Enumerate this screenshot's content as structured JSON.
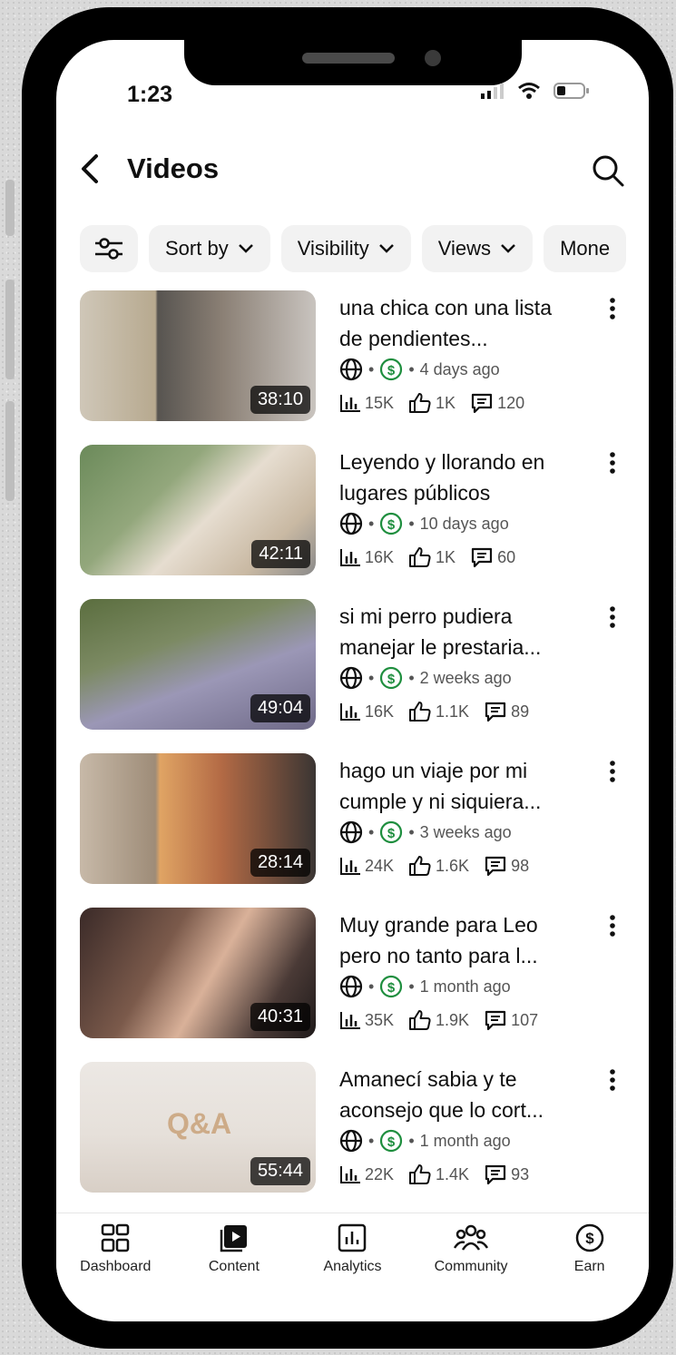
{
  "status": {
    "time": "1:23"
  },
  "header": {
    "title": "Videos"
  },
  "filters": [
    {
      "label": "Sort by"
    },
    {
      "label": "Visibility"
    },
    {
      "label": "Views"
    },
    {
      "label": "Mone"
    }
  ],
  "videos": [
    {
      "title": "una chica con una lista de pendientes...",
      "duration": "38:10",
      "age": "4 days ago",
      "views": "15K",
      "likes": "1K",
      "comments": "120"
    },
    {
      "title": "Leyendo y llorando en lugares públicos",
      "duration": "42:11",
      "age": "10 days ago",
      "views": "16K",
      "likes": "1K",
      "comments": "60"
    },
    {
      "title": "si mi perro pudiera manejar le prestaria...",
      "duration": "49:04",
      "age": "2 weeks ago",
      "views": "16K",
      "likes": "1.1K",
      "comments": "89"
    },
    {
      "title": "hago un viaje por mi cumple y ni siquiera...",
      "duration": "28:14",
      "age": "3 weeks ago",
      "views": "24K",
      "likes": "1.6K",
      "comments": "98"
    },
    {
      "title": "Muy grande para Leo pero no tanto para l...",
      "duration": "40:31",
      "age": "1 month ago",
      "views": "35K",
      "likes": "1.9K",
      "comments": "107"
    },
    {
      "title": "Amanecí sabia y te aconsejo que lo cort...",
      "duration": "55:44",
      "age": "1 month ago",
      "views": "22K",
      "likes": "1.4K",
      "comments": "93",
      "thumb_text": "Q&A"
    }
  ],
  "separator": "•",
  "tabs": [
    {
      "label": "Dashboard",
      "icon": "dashboard-icon"
    },
    {
      "label": "Content",
      "icon": "content-icon"
    },
    {
      "label": "Analytics",
      "icon": "analytics-icon"
    },
    {
      "label": "Community",
      "icon": "community-icon"
    },
    {
      "label": "Earn",
      "icon": "earn-icon"
    }
  ],
  "colors": {
    "monetization_green": "#1e8e3e",
    "text_primary": "#0f0f0f",
    "text_secondary": "#555555"
  }
}
